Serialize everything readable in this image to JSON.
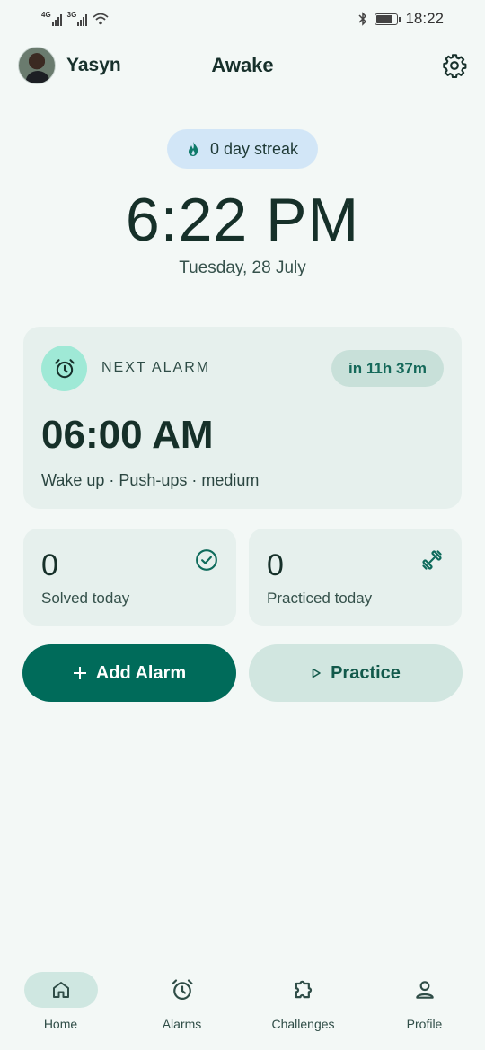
{
  "status_bar": {
    "net1": "4G",
    "net2": "3G",
    "time": "18:22"
  },
  "header": {
    "user_name": "Yasyn",
    "app_title": "Awake"
  },
  "streak": {
    "label": "0 day streak"
  },
  "clock": {
    "time": "6:22 PM",
    "date": "Tuesday, 28 July"
  },
  "next_alarm": {
    "heading": "NEXT ALARM",
    "countdown": "in 11h 37m",
    "time": "06:00 AM",
    "description": "Wake up · Push-ups · medium"
  },
  "stats": [
    {
      "value": "0",
      "label": "Solved today",
      "icon": "check-circle-icon"
    },
    {
      "value": "0",
      "label": "Practiced today",
      "icon": "dumbbell-icon"
    }
  ],
  "actions": {
    "add_label": "Add Alarm",
    "practice_label": "Practice"
  },
  "nav": [
    {
      "label": "Home",
      "icon": "home-icon",
      "active": true
    },
    {
      "label": "Alarms",
      "icon": "alarm-clock-icon",
      "active": false
    },
    {
      "label": "Challenges",
      "icon": "puzzle-icon",
      "active": false
    },
    {
      "label": "Profile",
      "icon": "person-icon",
      "active": false
    }
  ],
  "colors": {
    "background": "#f3f8f6",
    "primary": "#006b5a",
    "card": "#e6f0ed",
    "streak_pill": "#d2e6f7",
    "alarm_icon_bg": "#9fe9d6"
  }
}
